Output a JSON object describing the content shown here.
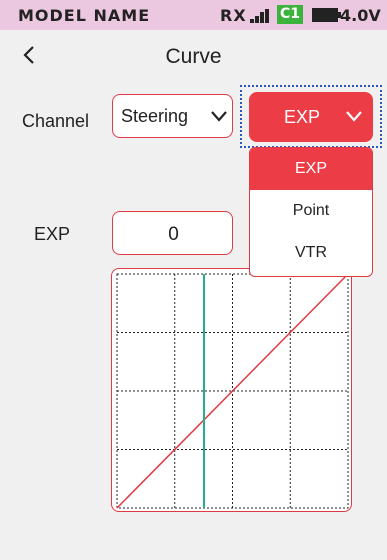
{
  "status_bar": {
    "model_name": "MODEL NAME",
    "rx": "RX",
    "channel_badge": "C1",
    "voltage": "4.0V",
    "badge_color": "#3cb33c",
    "background": "#ecc8e0"
  },
  "header": {
    "back_icon": "chevron-left-icon",
    "title": "Curve"
  },
  "channel": {
    "label": "Channel",
    "value": "Steering"
  },
  "curve_type": {
    "value": "EXP",
    "options": [
      {
        "label": "EXP",
        "selected": true
      },
      {
        "label": "Point",
        "selected": false
      },
      {
        "label": "VTR",
        "selected": false
      }
    ],
    "accent": "#ec3c46"
  },
  "exp": {
    "label": "EXP",
    "value": "0"
  },
  "graph": {
    "grid": "dotted 4x4",
    "curve_color": "#e03a44",
    "position_line_color": "#22b08a",
    "position_line_value": -0.2
  }
}
